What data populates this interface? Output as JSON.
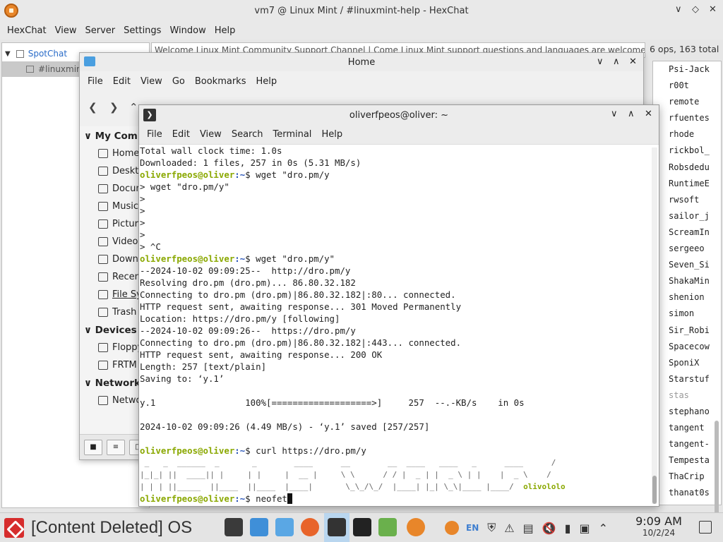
{
  "hexchat": {
    "title": "vm7 @ Linux Mint / #linuxmint-help - HexChat",
    "menu": [
      "HexChat",
      "View",
      "Server",
      "Settings",
      "Window",
      "Help"
    ],
    "server": "SpotChat",
    "channel": "#linuxmint-help",
    "topic": "Welcome Linux Mint Community Support Channel | Come Linux Mint support questions and languages are welcome",
    "user_count": "6 ops, 163 total",
    "users": [
      "Psi-Jack",
      "r00t",
      "remote",
      "rfuentes",
      "rhode",
      "rickbol_",
      "Robsdedu",
      "RuntimeE",
      "rwsoft",
      "sailor_j",
      "ScreamIn",
      "sergeeo",
      "Seven_Si",
      "ShakaMin",
      "shenion",
      "simon",
      "Sir_Robi",
      "Spacecow",
      "SponiX",
      "Starstuf",
      "stas",
      "stephano",
      "tangent",
      "tangent-",
      "Tempesta",
      "ThaCrip",
      "thanat0s"
    ],
    "away_users": [
      "stas"
    ]
  },
  "filemanager": {
    "title": "Home",
    "menu": [
      "File",
      "Edit",
      "View",
      "Go",
      "Bookmarks",
      "Help"
    ],
    "sections": {
      "my_computer": "My Computer",
      "devices": "Devices",
      "network": "Network"
    },
    "places": [
      "Home",
      "Desktop",
      "Documents",
      "Music",
      "Pictures",
      "Videos",
      "Downloads",
      "Recent",
      "File System",
      "Trash"
    ],
    "devices": [
      "Floppy",
      "FRTM"
    ],
    "network": [
      "Network"
    ]
  },
  "terminal": {
    "title": "oliverfpeos@oliver: ~",
    "menu": [
      "File",
      "Edit",
      "View",
      "Search",
      "Terminal",
      "Help"
    ],
    "prompt_user": "oliverfpeos@oliver",
    "prompt_path": ":~",
    "prompt_sym": "$ ",
    "lines": [
      {
        "t": "Total wall clock time: 1.0s"
      },
      {
        "t": "Downloaded: 1 files, 257 in 0s (5.31 MB/s)"
      },
      {
        "p": true,
        "t": "wget \"dro.pm/y"
      },
      {
        "t": "> wget \"dro.pm/y\""
      },
      {
        "t": ">"
      },
      {
        "t": ">"
      },
      {
        "t": ">"
      },
      {
        "t": ">"
      },
      {
        "t": "> ^C"
      },
      {
        "p": true,
        "t": "wget \"dro.pm/y\""
      },
      {
        "t": "--2024-10-02 09:09:25--  http://dro.pm/y"
      },
      {
        "t": "Resolving dro.pm (dro.pm)... 86.80.32.182"
      },
      {
        "t": "Connecting to dro.pm (dro.pm)|86.80.32.182|:80... connected."
      },
      {
        "t": "HTTP request sent, awaiting response... 301 Moved Permanently"
      },
      {
        "t": "Location: https://dro.pm/y [following]"
      },
      {
        "t": "--2024-10-02 09:09:26--  https://dro.pm/y"
      },
      {
        "t": "Connecting to dro.pm (dro.pm)|86.80.32.182|:443... connected."
      },
      {
        "t": "HTTP request sent, awaiting response... 200 OK"
      },
      {
        "t": "Length: 257 [text/plain]"
      },
      {
        "t": "Saving to: ‘y.1’"
      },
      {
        "t": ""
      },
      {
        "t": "y.1                 100%[===================>]     257  --.-KB/s    in 0s"
      },
      {
        "t": ""
      },
      {
        "t": "2024-10-02 09:09:26 (4.49 MB/s) - ‘y.1’ saved [257/257]"
      },
      {
        "t": ""
      },
      {
        "p": true,
        "t": "curl https://dro.pm/y"
      }
    ],
    "banner": [
      " _   _  ______  _       _        ____      __        __  ____   ____   _      ____      /",
      "|_|_| ||  ____|| |     | |     |  __ |     \\ \\      / / |  _ | |  _ \\ | |    |  _ \\    /",
      "| | | ||_____  ||____  ||____  |____|       \\_\\_/\\_/  |____| |_| \\_\\|____ |____/  "
    ],
    "banner_tail": "olivololo",
    "current_cmd": "neofet"
  },
  "taskbar": {
    "start_label": "[Content Deleted] OS",
    "keyboard_layout": "EN",
    "time": "9:09 AM",
    "date": "10/2/24"
  }
}
